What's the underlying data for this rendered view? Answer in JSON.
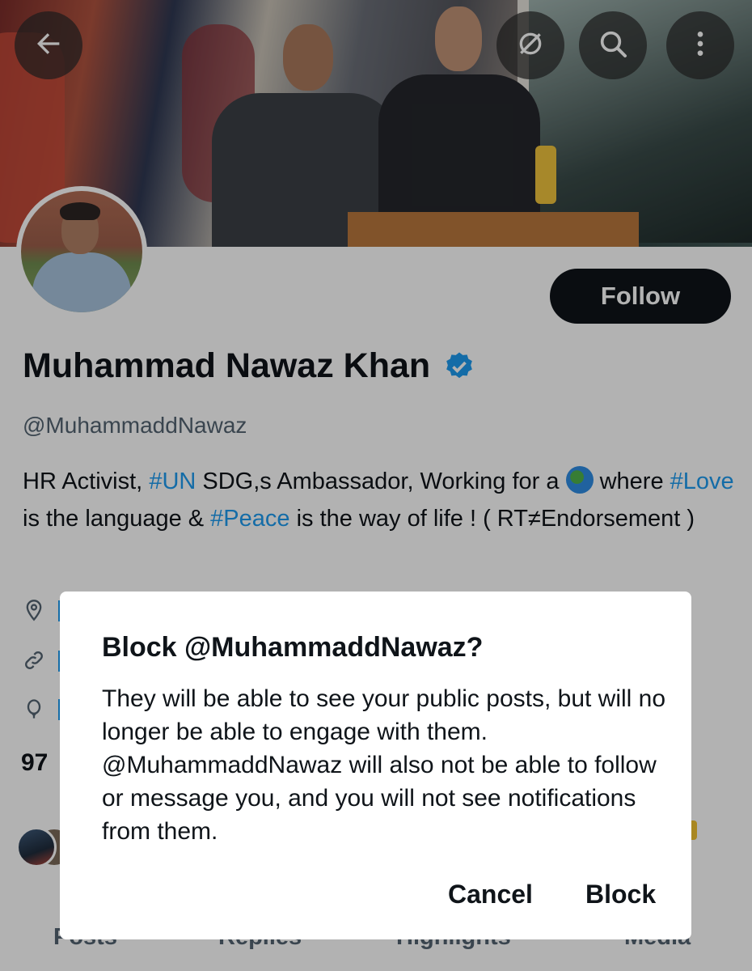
{
  "header": {
    "back_icon": "arrow-left-icon",
    "grok_icon": "grok-icon",
    "search_icon": "search-icon",
    "more_icon": "more-vertical-icon"
  },
  "profile": {
    "name": "Muhammad Nawaz Khan",
    "verified_icon": "verified-badge-icon",
    "handle": "@MuhammaddNawaz",
    "follow_label": "Follow",
    "bio": {
      "part1": "HR Activist, ",
      "tag_un": "#UN",
      "part2": " SDG,s Ambassador, Working for a ",
      "part3": " where ",
      "tag_love": "#Love",
      "part4": " is the language & ",
      "tag_peace": "#Peace",
      "part5": " is the way of life ! ( RT≠Endorsement )"
    },
    "following_count_partial": "97"
  },
  "tabs": [
    "Posts",
    "Replies",
    "Highlights",
    "Media"
  ],
  "dialog": {
    "title": "Block @MuhammaddNawaz?",
    "body": "They will be able to see your public posts, but will no longer be able to engage with them. @MuhammaddNawaz will also not be able to follow or message you, and you will not see notifications from them.",
    "cancel_label": "Cancel",
    "block_label": "Block"
  },
  "colors": {
    "accent": "#1d9bf0",
    "text": "#0f1419",
    "secondary_text": "#536471"
  }
}
